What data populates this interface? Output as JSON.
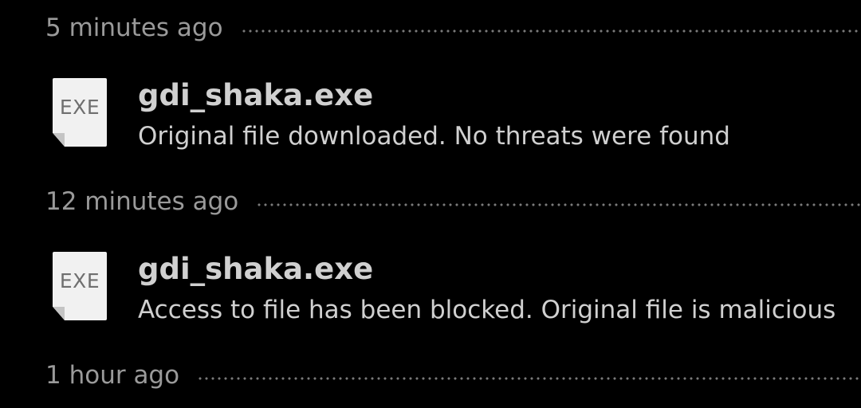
{
  "feed": {
    "groups": [
      {
        "time": "5 minutes ago",
        "item": {
          "icon": "exe-file-icon",
          "ext": "EXE",
          "name": "gdi_shaka.exe",
          "status": "Original file downloaded. No threats were found"
        }
      },
      {
        "time": "12 minutes ago",
        "item": {
          "icon": "exe-file-icon",
          "ext": "EXE",
          "name": "gdi_shaka.exe",
          "status": "Access to file has been blocked. Original file is malicious"
        }
      },
      {
        "time": "1 hour ago"
      }
    ]
  },
  "colors": {
    "background": "#000000",
    "time_text": "#9a9a9a",
    "primary_text": "#d0d0d0",
    "icon_background": "#f1f1f1",
    "icon_text": "#6f6f6f"
  }
}
